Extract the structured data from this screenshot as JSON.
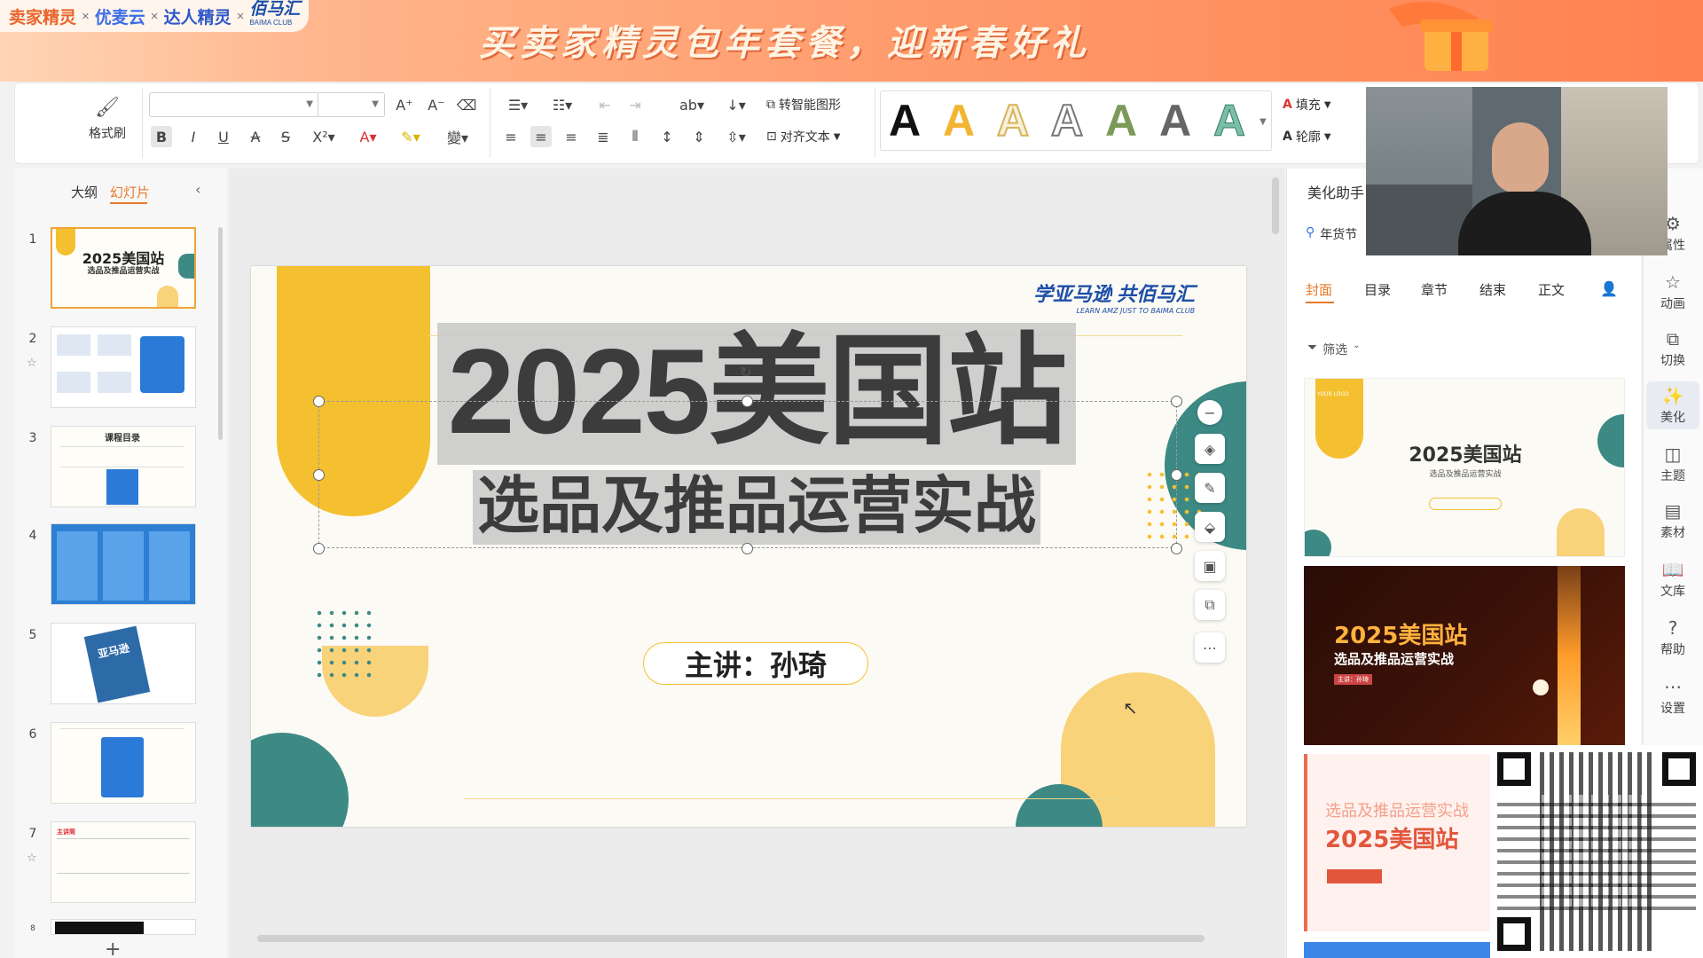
{
  "banner": {
    "brands": [
      "卖家精灵",
      "优麦云",
      "达人精灵",
      "佰马汇"
    ],
    "brand_sep": "×",
    "brand_sub": "BAIMA CLUB",
    "headline": "买卖家精灵包年套餐，迎新春好礼"
  },
  "ribbon": {
    "format_painter": "格式刷",
    "smart_shape": "转智能图形",
    "align_text": "对齐文本",
    "fill": "填充",
    "outline": "轮廓",
    "font_effect_letter": "A"
  },
  "left_panel": {
    "tabs": [
      "大纲",
      "幻灯片"
    ],
    "active_tab": "幻灯片",
    "slides": [
      {
        "num": "1",
        "title": "2025美国站",
        "subtitle": "选品及推品运营实战"
      },
      {
        "num": "2"
      },
      {
        "num": "3",
        "title": "课程目录"
      },
      {
        "num": "4"
      },
      {
        "num": "5",
        "title": "亚马逊"
      },
      {
        "num": "6"
      },
      {
        "num": "7",
        "title": "主讲简"
      },
      {
        "num": "8"
      }
    ],
    "add": "+"
  },
  "slide": {
    "logo": "学亚马逊 共佰马汇",
    "logo_sub": "LEARN AMZ JUST TO BAIMA CLUB",
    "title": "2025美国站",
    "subtitle": "选品及推品运营实战",
    "speaker": "主讲：孙琦"
  },
  "right_panel": {
    "title": "美化助手",
    "location": "年货节",
    "tabs": [
      "封面",
      "目录",
      "章节",
      "结束",
      "正文"
    ],
    "active_tab": "封面",
    "filter": "筛选",
    "templates": [
      {
        "title": "2025美国站",
        "subtitle": "选品及推品运营实战",
        "logo": "YOUR LOGO"
      },
      {
        "title": "2025美国站",
        "subtitle": "选品及推品运营实战",
        "tag": "主讲：孙琦"
      },
      {
        "title": "2025美国站",
        "subtitle": "选品及推品运营实战"
      }
    ]
  },
  "side_toolbar": [
    {
      "label": "属性",
      "icon": "properties-icon"
    },
    {
      "label": "动画",
      "icon": "star-icon"
    },
    {
      "label": "切换",
      "icon": "transition-icon"
    },
    {
      "label": "美化",
      "icon": "magic-icon"
    },
    {
      "label": "主题",
      "icon": "theme-icon"
    },
    {
      "label": "素材",
      "icon": "material-icon"
    },
    {
      "label": "文库",
      "icon": "library-icon"
    },
    {
      "label": "帮助",
      "icon": "help-icon"
    },
    {
      "label": "设置",
      "icon": "settings-icon"
    }
  ],
  "colors": {
    "accent_yellow": "#f5c02f",
    "teal": "#3d8a85",
    "banner_orange": "#ff8a5a",
    "active_orange": "#e8792b"
  }
}
